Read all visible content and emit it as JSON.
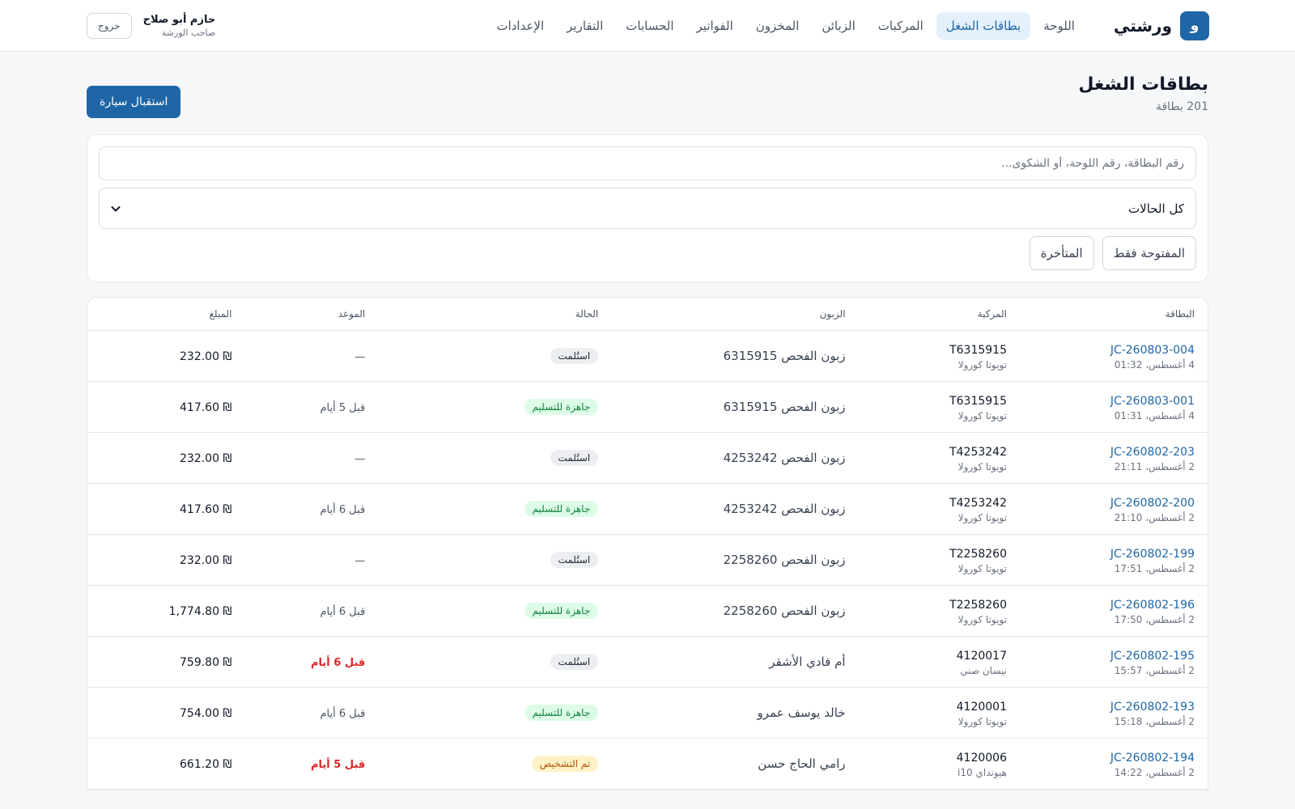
{
  "brand": {
    "logo_letter": "و",
    "name": "ورشتي",
    "accent": "#1e66a6"
  },
  "nav": [
    {
      "label": "اللوحة",
      "active": false
    },
    {
      "label": "بطاقات الشغل",
      "active": true
    },
    {
      "label": "المركبات",
      "active": false
    },
    {
      "label": "الزبائن",
      "active": false
    },
    {
      "label": "المخزون",
      "active": false
    },
    {
      "label": "الفواتير",
      "active": false
    },
    {
      "label": "الحسابات",
      "active": false
    },
    {
      "label": "التقارير",
      "active": false
    },
    {
      "label": "الإعدادات",
      "active": false
    }
  ],
  "user": {
    "name": "حازم أبو صلاح",
    "role": "صاحب الورشة",
    "logout_label": "خروج"
  },
  "page": {
    "title": "بطاقات الشغل",
    "subtitle": "201 بطاقة",
    "new_button": "استقبال سيارة"
  },
  "filters": {
    "search_placeholder": "رقم البطاقة، رقم اللوحة، أو الشكوى...",
    "status_selected": "كل الحالات",
    "chips": [
      "المفتوحة فقط",
      "المتأخرة"
    ]
  },
  "table": {
    "headers": [
      "البطاقة",
      "المركبة",
      "الزبون",
      "الحالة",
      "الموعد",
      "المبلغ"
    ],
    "rows": [
      {
        "id": "JC-260803-004",
        "date": "4 أغسطس، 01:32",
        "plate": "T6315915",
        "model": "تويوتا كورولا",
        "customer": "زبون الفحص 6315915",
        "status": "استُلمت",
        "status_kind": "delivered",
        "due": "—",
        "due_late": false,
        "amount": "232.00 ₪"
      },
      {
        "id": "JC-260803-001",
        "date": "4 أغسطس، 01:31",
        "plate": "T6315915",
        "model": "تويوتا كورولا",
        "customer": "زبون الفحص 6315915",
        "status": "جاهزة للتسليم",
        "status_kind": "ready",
        "due": "قبل 5 أيام",
        "due_late": false,
        "amount": "417.60 ₪"
      },
      {
        "id": "JC-260802-203",
        "date": "2 أغسطس، 21:11",
        "plate": "T4253242",
        "model": "تويوتا كورولا",
        "customer": "زبون الفحص 4253242",
        "status": "استُلمت",
        "status_kind": "delivered",
        "due": "—",
        "due_late": false,
        "amount": "232.00 ₪"
      },
      {
        "id": "JC-260802-200",
        "date": "2 أغسطس، 21:10",
        "plate": "T4253242",
        "model": "تويوتا كورولا",
        "customer": "زبون الفحص 4253242",
        "status": "جاهزة للتسليم",
        "status_kind": "ready",
        "due": "قبل 6 أيام",
        "due_late": false,
        "amount": "417.60 ₪"
      },
      {
        "id": "JC-260802-199",
        "date": "2 أغسطس، 17:51",
        "plate": "T2258260",
        "model": "تويوتا كورولا",
        "customer": "زبون الفحص 2258260",
        "status": "استُلمت",
        "status_kind": "delivered",
        "due": "—",
        "due_late": false,
        "amount": "232.00 ₪"
      },
      {
        "id": "JC-260802-196",
        "date": "2 أغسطس، 17:50",
        "plate": "T2258260",
        "model": "تويوتا كورولا",
        "customer": "زبون الفحص 2258260",
        "status": "جاهزة للتسليم",
        "status_kind": "ready",
        "due": "قبل 6 أيام",
        "due_late": false,
        "amount": "1,774.80 ₪"
      },
      {
        "id": "JC-260802-195",
        "date": "2 أغسطس، 15:57",
        "plate": "4120017",
        "model": "نيسان صني",
        "customer": "أم فادي الأشقر",
        "status": "استُلمت",
        "status_kind": "delivered",
        "due": "قبل 6 أيام",
        "due_late": true,
        "amount": "759.80 ₪"
      },
      {
        "id": "JC-260802-193",
        "date": "2 أغسطس، 15:18",
        "plate": "4120001",
        "model": "تويوتا كورولا",
        "customer": "خالد يوسف عمرو",
        "status": "جاهزة للتسليم",
        "status_kind": "ready",
        "due": "قبل 6 أيام",
        "due_late": false,
        "amount": "754.00 ₪"
      },
      {
        "id": "JC-260802-194",
        "date": "2 أغسطس، 14:22",
        "plate": "4120006",
        "model": "هيونداي i10",
        "customer": "رامي الحاج حسن",
        "status": "تم التشخيص",
        "status_kind": "diagnosed",
        "due": "قبل 5 أيام",
        "due_late": true,
        "amount": "661.20 ₪"
      }
    ]
  },
  "status_colors": {
    "delivered": {
      "bg": "#eceef1",
      "fg": "#1f2937"
    },
    "ready": {
      "bg": "#dcfce7",
      "fg": "#15803d"
    },
    "diagnosed": {
      "bg": "#fef3c7",
      "fg": "#b45309"
    }
  }
}
